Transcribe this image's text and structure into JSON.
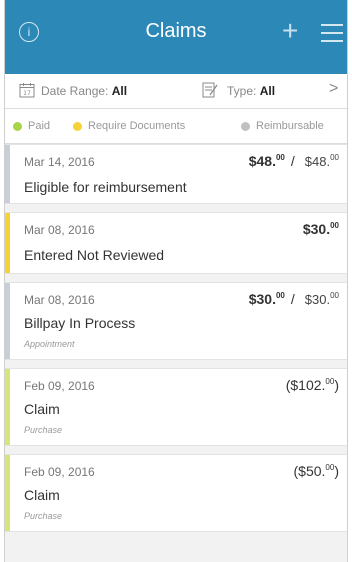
{
  "header": {
    "title": "Claims",
    "bg_color": "#2c88b7"
  },
  "filters": {
    "date_label": "Date Range: ",
    "date_value": "All",
    "type_label": "Type: ",
    "type_value": "All"
  },
  "legend": [
    {
      "label": "Paid",
      "color": "#a8d44a"
    },
    {
      "label": "Require Documents",
      "color": "#f5d237"
    },
    {
      "label": "Reimbursable",
      "color": "#c0c0c0"
    }
  ],
  "claims": [
    {
      "date": "Mar 14, 2016",
      "status": "Eligible for reimbursement",
      "category": "",
      "amount_main": "$48.",
      "amount_main_cents": "00",
      "amount_sep": "/",
      "amount_secondary": "$48.",
      "amount_secondary_cents": "00",
      "bar_color": "#c8cfd9",
      "parens": false
    },
    {
      "date": "Mar 08, 2016",
      "status": "Entered Not Reviewed",
      "category": "",
      "amount_main": "$30.",
      "amount_main_cents": "00",
      "amount_sep": "",
      "amount_secondary": "",
      "amount_secondary_cents": "",
      "bar_color": "#f5d237",
      "parens": false
    },
    {
      "date": "Mar 08, 2016",
      "status": "Billpay In Process",
      "category": "Appointment",
      "amount_main": "$30.",
      "amount_main_cents": "00",
      "amount_sep": "/",
      "amount_secondary": "$30.",
      "amount_secondary_cents": "00",
      "bar_color": "#c8cfd9",
      "parens": false
    },
    {
      "date": "Feb 09, 2016",
      "status": "Claim",
      "category": "Purchase",
      "amount_main": "($102.",
      "amount_main_cents": "00",
      "amount_main_close": ")",
      "amount_sep": "",
      "amount_secondary": "",
      "amount_secondary_cents": "",
      "bar_color": "#d7e57a",
      "parens": true
    },
    {
      "date": "Feb 09, 2016",
      "status": "Claim",
      "category": "Purchase",
      "amount_main": "($50.",
      "amount_main_cents": "00",
      "amount_main_close": ")",
      "amount_sep": "",
      "amount_secondary": "",
      "amount_secondary_cents": "",
      "bar_color": "#d7e57a",
      "parens": true
    }
  ]
}
